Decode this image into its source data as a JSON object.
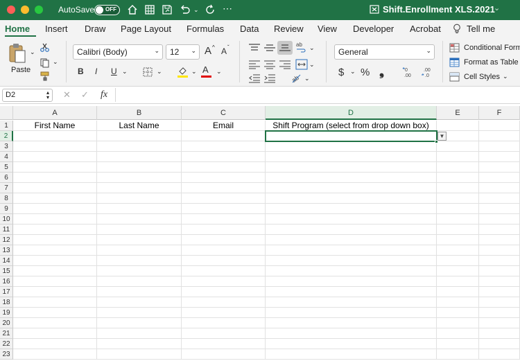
{
  "titlebar": {
    "autosave_label": "AutoSave",
    "autosave_state": "OFF",
    "file_name": "Shift.Enrollment XLS.2021",
    "bg_color": "#207245"
  },
  "tabs": [
    "Home",
    "Insert",
    "Draw",
    "Page Layout",
    "Formulas",
    "Data",
    "Review",
    "View",
    "Developer",
    "Acrobat",
    "Tell me"
  ],
  "ribbon": {
    "paste_label": "Paste",
    "font_name": "Calibri (Body)",
    "font_size": "12",
    "grow_font": "A",
    "shrink_font": "A",
    "bold": "B",
    "italic": "I",
    "underline": "U",
    "font_color_letter": "A",
    "number_format": "General",
    "currency": "$",
    "percent": "%",
    "comma": "❟",
    "conditional_formatting": "Conditional Formatting",
    "format_as_table": "Format as Table",
    "cell_styles": "Cell Styles"
  },
  "formula_bar": {
    "name_box": "D2",
    "fx": "fx",
    "value": ""
  },
  "grid": {
    "columns": [
      "A",
      "B",
      "C",
      "D",
      "E",
      "F"
    ],
    "selected_column": "D",
    "selected_row": 2,
    "rows": [
      1,
      2,
      3,
      4,
      5,
      6,
      7,
      8,
      9,
      10,
      11,
      12,
      13,
      14,
      15,
      16,
      17,
      18,
      19,
      20,
      21,
      22,
      23
    ],
    "headers": {
      "A1": "First Name",
      "B1": "Last Name",
      "C1": "Email",
      "D1": "Shift Program (select from drop down box)"
    }
  }
}
